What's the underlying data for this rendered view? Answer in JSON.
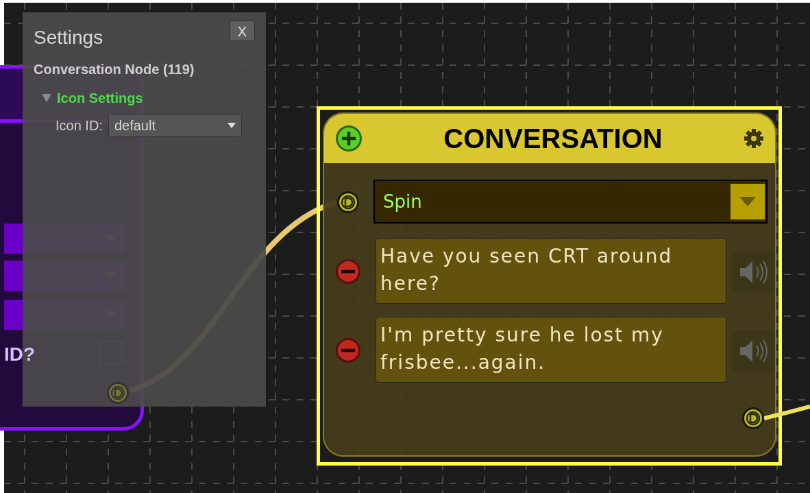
{
  "left_node": {
    "checkbox_label": "**ID**?",
    "checked": false
  },
  "settings_panel": {
    "title": "Settings",
    "close": "X",
    "subtitle": "Conversation Node (119)",
    "section": {
      "label": "Icon Settings",
      "expanded": true,
      "fields": [
        {
          "label": "Icon ID:",
          "value": "default"
        }
      ]
    }
  },
  "conversation_node": {
    "title": "CONVERSATION",
    "selected": true,
    "dropdown": "Spin",
    "lines": [
      {
        "text": "Have you seen CRT around here?"
      },
      {
        "text": "I'm pretty sure he lost my frisbee...again."
      }
    ]
  }
}
